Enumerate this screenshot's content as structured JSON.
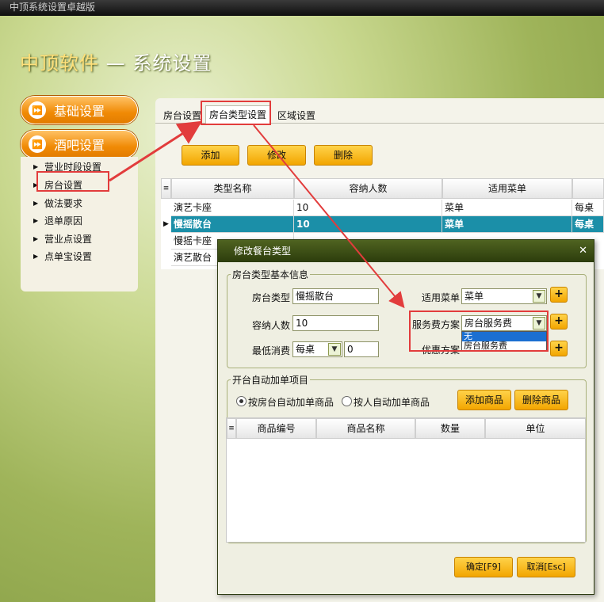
{
  "window": {
    "title": "中顶系统设置卓越版"
  },
  "app": {
    "title_main": "中顶软件",
    "title_sep": "—",
    "title_sub": "系统设置"
  },
  "sidebar": {
    "basic_label": "基础设置",
    "bar_label": "酒吧设置",
    "items": [
      {
        "label": "营业时段设置"
      },
      {
        "label": "房台设置"
      },
      {
        "label": "做法要求"
      },
      {
        "label": "退单原因"
      },
      {
        "label": "营业点设置"
      },
      {
        "label": "点单宝设置"
      }
    ]
  },
  "tabs": [
    {
      "label": "房台设置"
    },
    {
      "label": "房台类型设置"
    },
    {
      "label": "区域设置"
    }
  ],
  "toolbar": {
    "add": "添加",
    "edit": "修改",
    "delete": "删除"
  },
  "grid": {
    "columns": [
      "类型名称",
      "容纳人数",
      "适用菜单"
    ],
    "rows": [
      {
        "name": "演艺卡座",
        "capacity": "10",
        "menu": "菜单",
        "extra": "每桌"
      },
      {
        "name": "慢摇散台",
        "capacity": "10",
        "menu": "菜单",
        "extra": "每桌"
      },
      {
        "name": "慢摇卡座",
        "capacity": "",
        "menu": "",
        "extra": ""
      },
      {
        "name": "演艺散台",
        "capacity": "",
        "menu": "",
        "extra": ""
      }
    ]
  },
  "dialog": {
    "title": "修改餐台类型",
    "basic_group": "房台类型基本信息",
    "type_label": "房台类型",
    "type_value": "慢摇散台",
    "capacity_label": "容纳人数",
    "capacity_value": "10",
    "min_label": "最低消费",
    "min_unit": "每桌",
    "min_value": "0",
    "menu_label": "适用菜单",
    "menu_value": "菜单",
    "fee_label": "服务费方案",
    "fee_value": "房台服务费",
    "fee_options": [
      "无",
      "房台服务费"
    ],
    "discount_label": "优惠方案",
    "auto_group": "开台自动加单项目",
    "radio_by_table": "按房台自动加单商品",
    "radio_by_person": "按人自动加单商品",
    "add_goods": "添加商品",
    "del_goods": "删除商品",
    "goods_columns": [
      "商品编号",
      "商品名称",
      "数量",
      "单位"
    ],
    "ok": "确定[F9]",
    "cancel": "取消[Esc]"
  }
}
